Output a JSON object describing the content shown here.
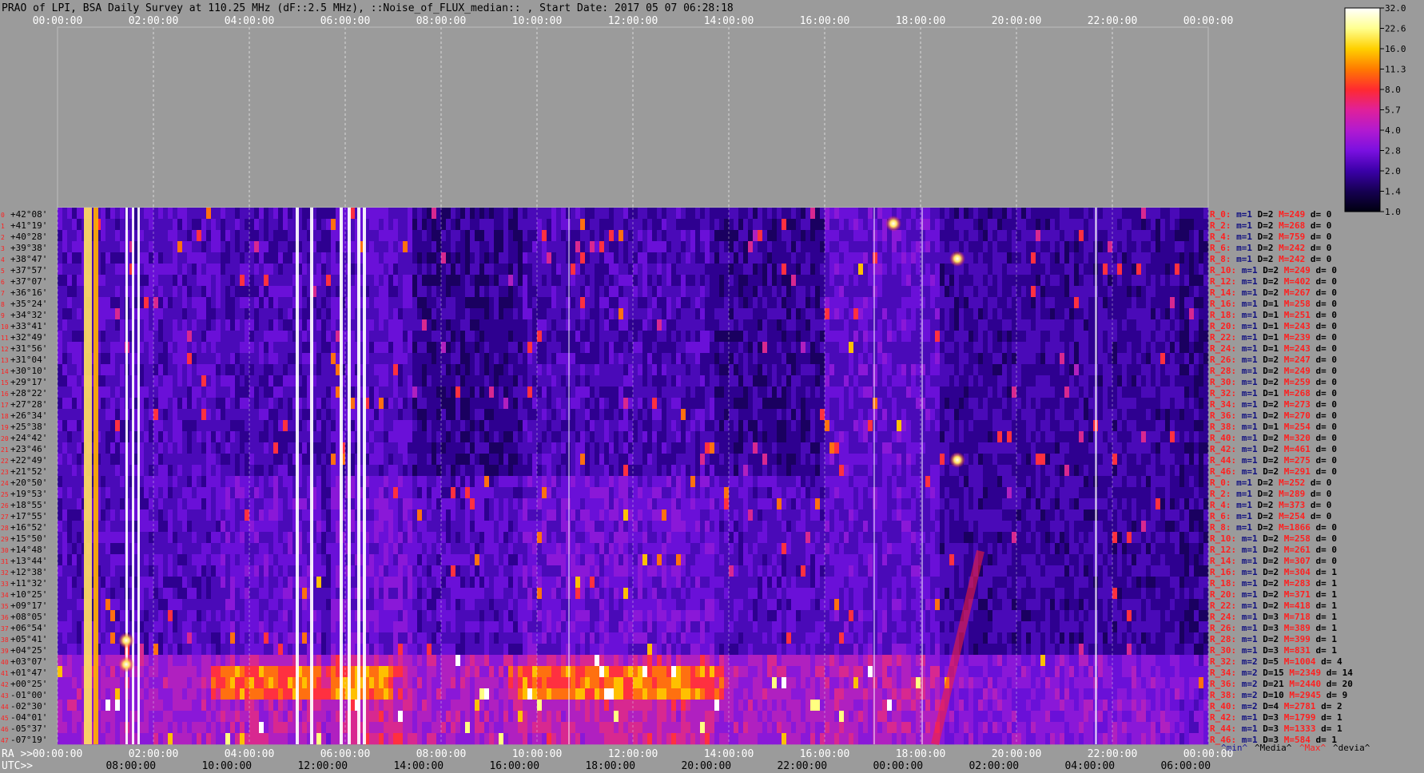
{
  "header": {
    "title": "PRAO of LPI, BSA Daily Survey at 110.25 MHz (dF::2.5 MHz), ::Noise_of_FLUX_median:: , Start Date: 2017 05 07 06:28:18"
  },
  "chart_data": {
    "type": "heatmap",
    "title": "PRAO of LPI, BSA Daily Survey at 110.25 MHz (dF::2.5 MHz), ::Noise_of_FLUX_median:: , Start Date: 2017 05 07 06:28:18",
    "top_ticks": [
      "00:00:00",
      "02:00:00",
      "04:00:00",
      "06:00:00",
      "08:00:00",
      "10:00:00",
      "12:00:00",
      "14:00:00",
      "16:00:00",
      "18:00:00",
      "20:00:00",
      "22:00:00",
      "00:00:00"
    ],
    "ra_ticks": [
      "00:00:00",
      "02:00:00",
      "04:00:00",
      "06:00:00",
      "08:00:00",
      "10:00:00",
      "12:00:00",
      "14:00:00",
      "16:00:00",
      "18:00:00",
      "20:00:00",
      "22:00:00",
      "00:00:00"
    ],
    "utc_ticks": [
      "08:00:00",
      "10:00:00",
      "12:00:00",
      "14:00:00",
      "16:00:00",
      "18:00:00",
      "20:00:00",
      "22:00:00",
      "00:00:00",
      "02:00:00",
      "04:00:00",
      "06:00:00"
    ],
    "ra_axis_label": "RA >>",
    "utc_axis_label": "UTC>>",
    "colorbar": {
      "ticks": [
        "32.0",
        "22.6",
        "16.0",
        "11.3",
        "8.0",
        "5.7",
        "4.0",
        "2.8",
        "2.0",
        "1.4",
        "1.0"
      ],
      "colors": [
        "#000010",
        "#160052",
        "#3b00a8",
        "#7a10e0",
        "#b21ad0",
        "#e0209a",
        "#ff2a30",
        "#ff7a00",
        "#ffd000",
        "#ffff90",
        "#ffffff"
      ]
    },
    "declinations": [
      "+42°08'",
      "+41°19'",
      "+40°28'",
      "+39°38'",
      "+38°47'",
      "+37°57'",
      "+37°07'",
      "+36°16'",
      "+35°24'",
      "+34°32'",
      "+33°41'",
      "+32°49'",
      "+31°56'",
      "+31°04'",
      "+30°10'",
      "+29°17'",
      "+28°22'",
      "+27°28'",
      "+26°34'",
      "+25°38'",
      "+24°42'",
      "+23°46'",
      "+22°49'",
      "+21°52'",
      "+20°50'",
      "+19°53'",
      "+18°55'",
      "+17°55'",
      "+16°52'",
      "+15°50'",
      "+14°48'",
      "+13°44'",
      "+12°38'",
      "+11°32'",
      "+10°25'",
      "+09°17'",
      "+08°05'",
      "+06°54'",
      "+05°41'",
      "+04°25'",
      "+03°07'",
      "+01°47'",
      "+00°25'",
      "-01°00'",
      "-02°30'",
      "-04°01'",
      "-05°37'",
      "-07°19'"
    ],
    "row_index_labels": [
      "0",
      "1",
      "2",
      "3",
      "4",
      "5",
      "6",
      "7",
      "8",
      "9",
      "10",
      "11",
      "12",
      "13",
      "14",
      "15",
      "16",
      "17",
      "18",
      "19",
      "20",
      "21",
      "22",
      "23",
      "24",
      "25",
      "26",
      "27",
      "28",
      "29",
      "30",
      "31",
      "32",
      "33",
      "34",
      "35",
      "36",
      "37",
      "38",
      "39",
      "40",
      "41",
      "42",
      "43",
      "44",
      "45",
      "46",
      "47"
    ],
    "receivers": [
      {
        "r": "R_0:",
        "m": "m=1",
        "D": "D=2",
        "M": "M=249",
        "d": "d= 0"
      },
      {
        "r": "R_2:",
        "m": "m=1",
        "D": "D=2",
        "M": "M=268",
        "d": "d= 0"
      },
      {
        "r": "R_4:",
        "m": "m=1",
        "D": "D=2",
        "M": "M=759",
        "d": "d= 0"
      },
      {
        "r": "R_6:",
        "m": "m=1",
        "D": "D=2",
        "M": "M=242",
        "d": "d= 0"
      },
      {
        "r": "R_8:",
        "m": "m=1",
        "D": "D=2",
        "M": "M=242",
        "d": "d= 0"
      },
      {
        "r": "R_10:",
        "m": "m=1",
        "D": "D=2",
        "M": "M=249",
        "d": "d= 0"
      },
      {
        "r": "R_12:",
        "m": "m=1",
        "D": "D=2",
        "M": "M=402",
        "d": "d= 0"
      },
      {
        "r": "R_14:",
        "m": "m=1",
        "D": "D=2",
        "M": "M=267",
        "d": "d= 0"
      },
      {
        "r": "R_16:",
        "m": "m=1",
        "D": "D=1",
        "M": "M=258",
        "d": "d= 0"
      },
      {
        "r": "R_18:",
        "m": "m=1",
        "D": "D=1",
        "M": "M=251",
        "d": "d= 0"
      },
      {
        "r": "R_20:",
        "m": "m=1",
        "D": "D=1",
        "M": "M=243",
        "d": "d= 0"
      },
      {
        "r": "R_22:",
        "m": "m=1",
        "D": "D=1",
        "M": "M=239",
        "d": "d= 0"
      },
      {
        "r": "R_24:",
        "m": "m=1",
        "D": "D=1",
        "M": "M=243",
        "d": "d= 0"
      },
      {
        "r": "R_26:",
        "m": "m=1",
        "D": "D=2",
        "M": "M=247",
        "d": "d= 0"
      },
      {
        "r": "R_28:",
        "m": "m=1",
        "D": "D=2",
        "M": "M=249",
        "d": "d= 0"
      },
      {
        "r": "R_30:",
        "m": "m=1",
        "D": "D=2",
        "M": "M=259",
        "d": "d= 0"
      },
      {
        "r": "R_32:",
        "m": "m=1",
        "D": "D=1",
        "M": "M=268",
        "d": "d= 0"
      },
      {
        "r": "R_34:",
        "m": "m=1",
        "D": "D=2",
        "M": "M=273",
        "d": "d= 0"
      },
      {
        "r": "R_36:",
        "m": "m=1",
        "D": "D=2",
        "M": "M=270",
        "d": "d= 0"
      },
      {
        "r": "R_38:",
        "m": "m=1",
        "D": "D=1",
        "M": "M=254",
        "d": "d= 0"
      },
      {
        "r": "R_40:",
        "m": "m=1",
        "D": "D=2",
        "M": "M=320",
        "d": "d= 0"
      },
      {
        "r": "R_42:",
        "m": "m=1",
        "D": "D=2",
        "M": "M=461",
        "d": "d= 0"
      },
      {
        "r": "R_44:",
        "m": "m=1",
        "D": "D=2",
        "M": "M=275",
        "d": "d= 0"
      },
      {
        "r": "R_46:",
        "m": "m=1",
        "D": "D=2",
        "M": "M=291",
        "d": "d= 0"
      },
      {
        "r": "R_0:",
        "m": "m=1",
        "D": "D=2",
        "M": "M=252",
        "d": "d= 0"
      },
      {
        "r": "R_2:",
        "m": "m=1",
        "D": "D=2",
        "M": "M=289",
        "d": "d= 0"
      },
      {
        "r": "R_4:",
        "m": "m=1",
        "D": "D=2",
        "M": "M=373",
        "d": "d= 0"
      },
      {
        "r": "R_6:",
        "m": "m=1",
        "D": "D=2",
        "M": "M=254",
        "d": "d= 0"
      },
      {
        "r": "R_8:",
        "m": "m=1",
        "D": "D=2",
        "M": "M=1866",
        "d": "d= 0"
      },
      {
        "r": "R_10:",
        "m": "m=1",
        "D": "D=2",
        "M": "M=258",
        "d": "d= 0"
      },
      {
        "r": "R_12:",
        "m": "m=1",
        "D": "D=2",
        "M": "M=261",
        "d": "d= 0"
      },
      {
        "r": "R_14:",
        "m": "m=1",
        "D": "D=2",
        "M": "M=307",
        "d": "d= 0"
      },
      {
        "r": "R_16:",
        "m": "m=1",
        "D": "D=2",
        "M": "M=304",
        "d": "d= 1"
      },
      {
        "r": "R_18:",
        "m": "m=1",
        "D": "D=2",
        "M": "M=283",
        "d": "d= 1"
      },
      {
        "r": "R_20:",
        "m": "m=1",
        "D": "D=2",
        "M": "M=371",
        "d": "d= 1"
      },
      {
        "r": "R_22:",
        "m": "m=1",
        "D": "D=2",
        "M": "M=418",
        "d": "d= 1"
      },
      {
        "r": "R_24:",
        "m": "m=1",
        "D": "D=3",
        "M": "M=718",
        "d": "d= 1"
      },
      {
        "r": "R_26:",
        "m": "m=1",
        "D": "D=3",
        "M": "M=389",
        "d": "d= 1"
      },
      {
        "r": "R_28:",
        "m": "m=1",
        "D": "D=2",
        "M": "M=399",
        "d": "d= 1"
      },
      {
        "r": "R_30:",
        "m": "m=1",
        "D": "D=3",
        "M": "M=831",
        "d": "d= 1"
      },
      {
        "r": "R_32:",
        "m": "m=2",
        "D": "D=5",
        "M": "M=1004",
        "d": "d= 4"
      },
      {
        "r": "R_34:",
        "m": "m=2",
        "D": "D=15",
        "M": "M=2349",
        "d": "d= 14"
      },
      {
        "r": "R_36:",
        "m": "m=2",
        "D": "D=21",
        "M": "M=2440",
        "d": "d= 20"
      },
      {
        "r": "R_38:",
        "m": "m=2",
        "D": "D=10",
        "M": "M=2945",
        "d": "d= 9"
      },
      {
        "r": "R_40:",
        "m": "m=2",
        "D": "D=4",
        "M": "M=2781",
        "d": "d= 2"
      },
      {
        "r": "R_42:",
        "m": "m=1",
        "D": "D=3",
        "M": "M=1799",
        "d": "d= 1"
      },
      {
        "r": "R_44:",
        "m": "m=1",
        "D": "D=3",
        "M": "M=1333",
        "d": "d= 1"
      },
      {
        "r": "R_46:",
        "m": "m=1",
        "D": "D=3",
        "M": "M=584",
        "d": "d= 1"
      }
    ],
    "legend_items": [
      {
        "label": "^min^",
        "color": "#1a1a9a"
      },
      {
        "label": "^Media^",
        "color": "#000000"
      },
      {
        "label": "^Max^",
        "color": "#ff2020"
      },
      {
        "label": "^devia^",
        "color": "#000000"
      }
    ]
  }
}
